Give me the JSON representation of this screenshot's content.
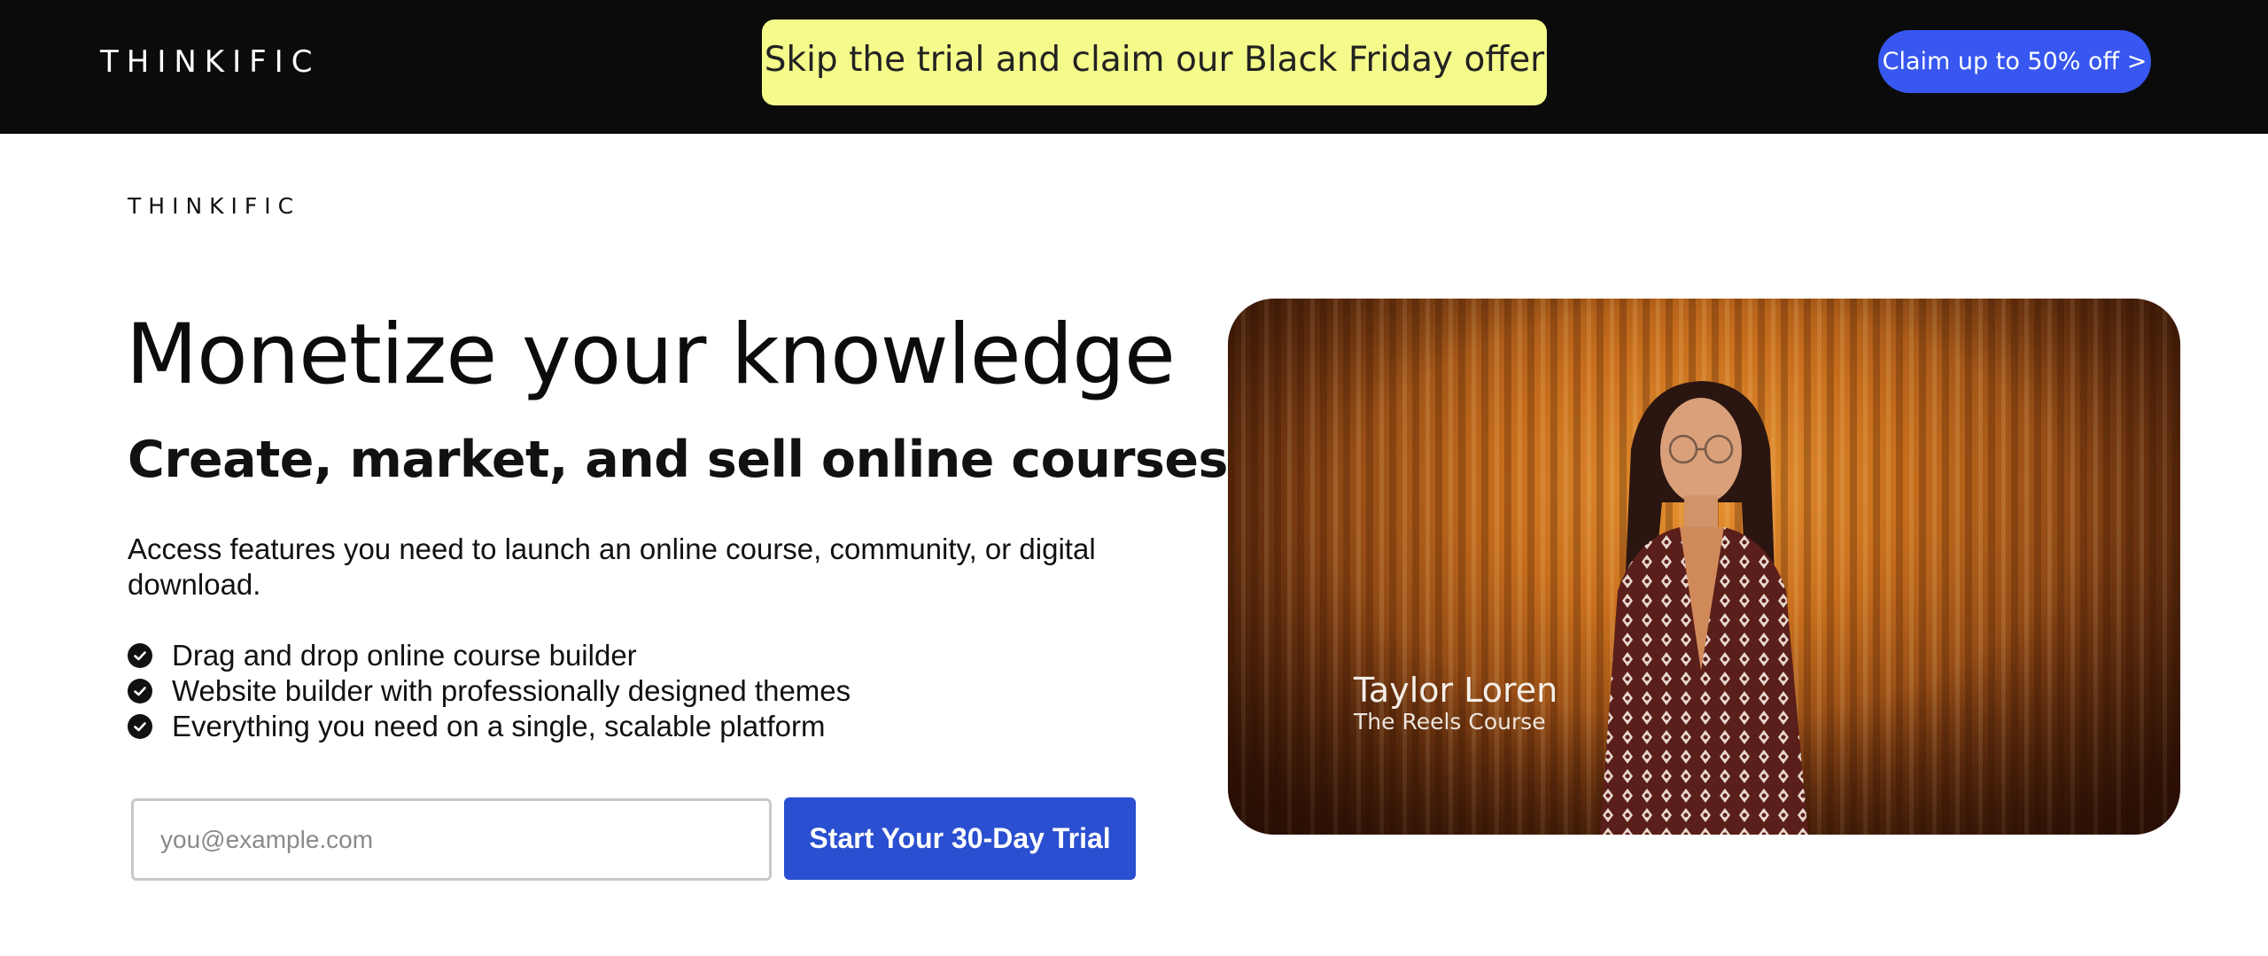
{
  "promo": {
    "logo": "THINKIFIC",
    "offer_text": "Skip the trial and claim our Black Friday offer",
    "claim_button": "Claim up to 50% off >"
  },
  "header": {
    "logo": "THINKIFIC"
  },
  "hero": {
    "title": "Monetize your knowledge",
    "subtitle": "Create, market, and sell online courses.",
    "description": "Access features you need to launch an online course, community, or digital download.",
    "features": [
      "Drag and drop online course builder",
      "Website builder with professionally designed themes",
      "Everything you need on a single, scalable platform"
    ]
  },
  "signup": {
    "email_placeholder": "you@example.com",
    "cta_label": "Start Your 30-Day Trial"
  },
  "video": {
    "name": "Taylor Loren",
    "course": "The Reels Course"
  },
  "colors": {
    "promo_bg": "#0b0b0b",
    "offer_bg": "#f5fb8b",
    "claim_bg": "#3757f0",
    "cta_bg": "#2a4fd0"
  }
}
